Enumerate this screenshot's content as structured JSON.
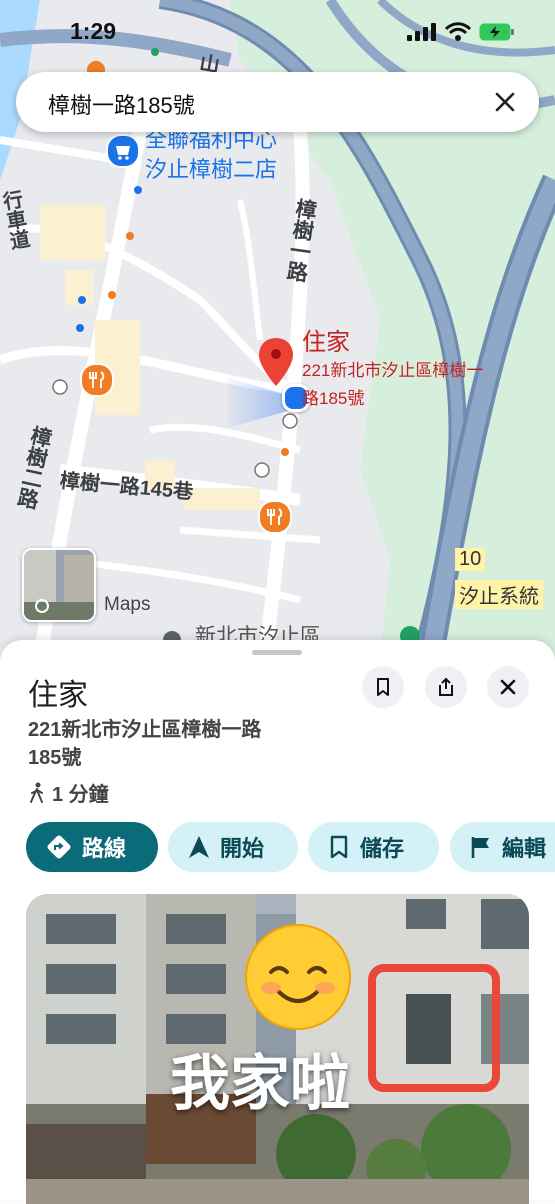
{
  "status": {
    "time": "1:29"
  },
  "search": {
    "query": "樟樹一路185號"
  },
  "map": {
    "labels": {
      "road_top": "山",
      "store_line1": "全聯福利中心",
      "store_line2": "汐止樟樹二店",
      "road_tree1_vertical": "樟樹一路",
      "road_tree2_vertical": "樟樹二路",
      "lane145": "樟樹一路145巷",
      "district": "新北市汐止區",
      "road_left": "行車道",
      "maps_brand": "Maps",
      "interchange_num": "10",
      "interchange_name": "汐止系統"
    },
    "pin": {
      "title": "住家",
      "address_line1": "221新北市汐止區樟樹一",
      "address_line2": "路185號"
    }
  },
  "place": {
    "title": "住家",
    "address_line1": "221新北市汐止區樟樹一路",
    "address_line2": "185號",
    "walk_time": "1 分鐘",
    "actions": {
      "directions": "路線",
      "start": "開始",
      "save": "儲存",
      "edit": "編輯"
    }
  },
  "photo_overlay": {
    "emoji": "☺️",
    "text": "我家啦"
  },
  "colors": {
    "primary_teal": "#0b6b78",
    "chip_bg": "#d3f1f6",
    "pin_red": "#c5221f",
    "highlight_box": "#e8473a"
  }
}
